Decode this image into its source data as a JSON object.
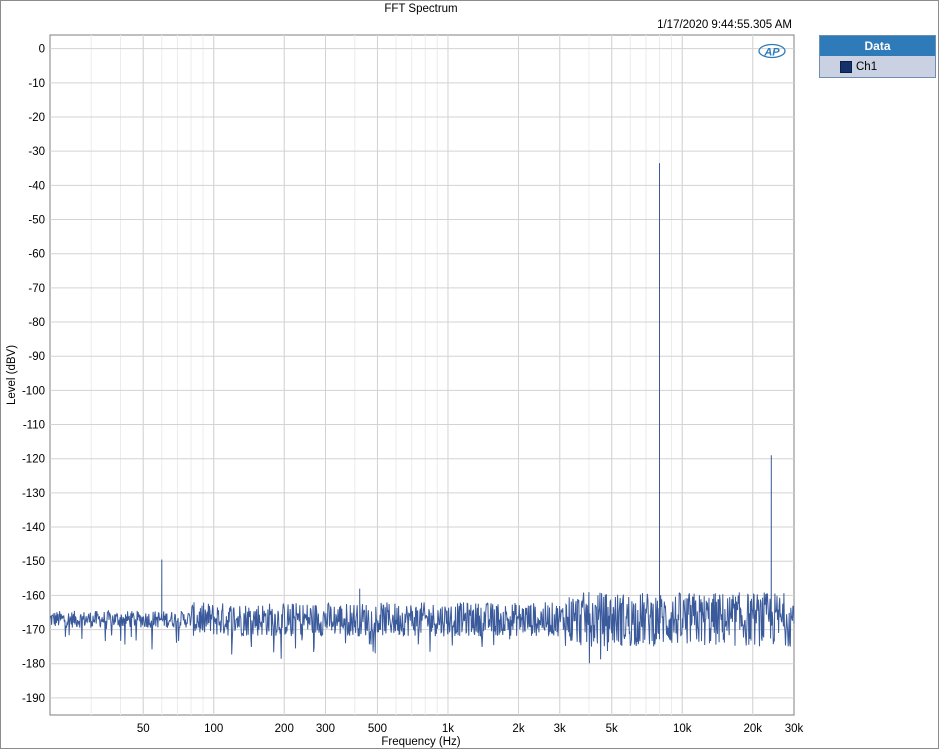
{
  "chart_data": {
    "type": "line",
    "title": "FFT Spectrum",
    "timestamp": "1/17/2020 9:44:55.305 AM",
    "xlabel": "Frequency (Hz)",
    "ylabel": "Level (dBV)",
    "x_scale": "log",
    "xlim": [
      20,
      30000
    ],
    "ylim": [
      -195,
      4
    ],
    "grid": true,
    "logo_text": "AP",
    "x_ticks": [
      {
        "value": 50,
        "label": "50"
      },
      {
        "value": 100,
        "label": "100"
      },
      {
        "value": 200,
        "label": "200"
      },
      {
        "value": 300,
        "label": "300"
      },
      {
        "value": 500,
        "label": "500"
      },
      {
        "value": 1000,
        "label": "1k"
      },
      {
        "value": 2000,
        "label": "2k"
      },
      {
        "value": 3000,
        "label": "3k"
      },
      {
        "value": 5000,
        "label": "5k"
      },
      {
        "value": 10000,
        "label": "10k"
      },
      {
        "value": 20000,
        "label": "20k"
      },
      {
        "value": 30000,
        "label": "30k"
      }
    ],
    "y_ticks": [
      0,
      -10,
      -20,
      -30,
      -40,
      -50,
      -60,
      -70,
      -80,
      -90,
      -100,
      -110,
      -120,
      -130,
      -140,
      -150,
      -160,
      -170,
      -180,
      -190
    ],
    "legend": {
      "title": "Data",
      "position": "right",
      "items": [
        {
          "name": "Ch1",
          "color": "#15316b"
        }
      ]
    },
    "series": [
      {
        "name": "Ch1",
        "color": "#3a5a9b",
        "noise_floor_dbv": -167,
        "peaks": [
          {
            "x": 60,
            "y": -149.5
          },
          {
            "x": 420,
            "y": -158
          },
          {
            "x": 8000,
            "y": -33.5
          },
          {
            "x": 24000,
            "y": -119
          }
        ]
      }
    ]
  }
}
